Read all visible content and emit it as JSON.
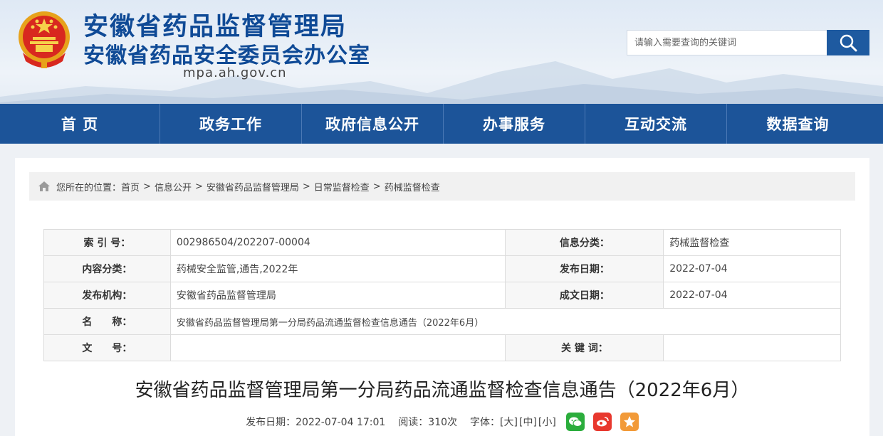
{
  "header": {
    "title1": "安徽省药品监督管理局",
    "title2": "安徽省药品安全委员会办公室",
    "url": "mpa.ah.gov.cn",
    "search_placeholder": "请输入需要查询的关键词",
    "search_icon": "search-icon"
  },
  "nav": {
    "items": [
      "首 页",
      "政务工作",
      "政府信息公开",
      "办事服务",
      "互动交流",
      "数据查询"
    ]
  },
  "breadcrumb": {
    "prefix": "您所在的位置：",
    "items": [
      "首页",
      "信息公开",
      "安徽省药品监督管理局",
      "日常监督检查",
      "药械监督检查"
    ],
    "separator": ">"
  },
  "meta": {
    "index_label": "索 引 号：",
    "index_value": "002986504/202207-00004",
    "category_label": "信息分类：",
    "category_value": "药械监督检查",
    "content_label": "内容分类：",
    "content_value": "药械安全监管,通告,2022年",
    "pubdate_label": "发布日期：",
    "pubdate_value": "2022-07-04",
    "org_label": "发布机构：",
    "org_value": "安徽省药品监督管理局",
    "createdate_label": "成文日期：",
    "createdate_value": "2022-07-04",
    "name_label": "名　　称：",
    "name_value": "安徽省药品监督管理局第一分局药品流通监督检查信息通告（2022年6月）",
    "docno_label": "文　　号：",
    "docno_value": "",
    "keyword_label": "关 键 词：",
    "keyword_value": ""
  },
  "article": {
    "title": "安徽省药品监督管理局第一分局药品流通监督检查信息通告（2022年6月）",
    "published": "发布日期：2022-07-04 17:01",
    "views": "阅读：310次",
    "font_label": "字体：",
    "font_large": "[大]",
    "font_medium": "[中]",
    "font_small": "[小]"
  },
  "colors": {
    "brand_blue": "#1c5499",
    "title_blue": "#0f4a96",
    "wechat_green": "#2bad3c",
    "weibo_red": "#e8382e",
    "favorite_orange": "#f29a38"
  }
}
